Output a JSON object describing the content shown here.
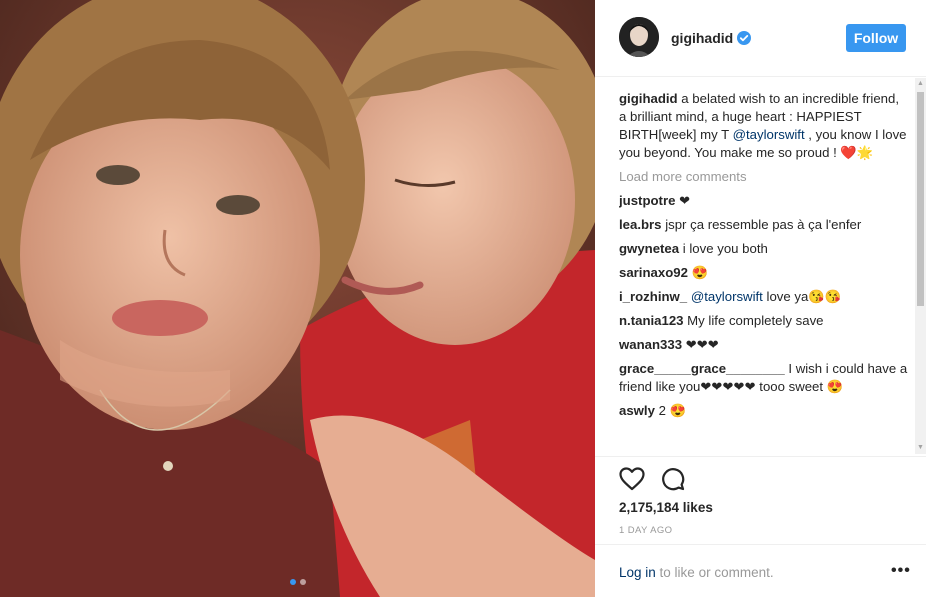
{
  "post": {
    "username": "gigihadid",
    "follow_label": "Follow",
    "caption": {
      "username": "gigihadid",
      "text_before": " a belated wish to an incredible friend, a brilliant mind, a huge heart : HAPPIEST BIRTH[week] my T ",
      "mention": "@taylorswift",
      "text_after": " , you know I love you beyond. You make me so proud ! ❤️🌟"
    },
    "load_more": "Load more comments",
    "comments": [
      {
        "user": "justpotre",
        "mention": "",
        "text": " ❤"
      },
      {
        "user": "lea.brs",
        "mention": "",
        "text": " jspr ça ressemble pas à ça l'enfer"
      },
      {
        "user": "gwynetea",
        "mention": "",
        "text": " i love you both"
      },
      {
        "user": "sarinaxo92",
        "mention": "",
        "text": " 😍"
      },
      {
        "user": "i_rozhinw_",
        "mention": " @taylorswift",
        "text": " love ya😘😘"
      },
      {
        "user": "n.tania123",
        "mention": "",
        "text": " My life completely save"
      },
      {
        "user": "wanan333",
        "mention": "",
        "text": " ❤❤❤"
      },
      {
        "user": "grace_____grace________",
        "mention": "",
        "text": " I wish i could have a friend like you❤❤❤❤❤ tooo sweet 😍"
      },
      {
        "user": "aswly",
        "mention": "",
        "text": " 2 😍"
      }
    ],
    "likes": "2,175,184 likes",
    "timestamp": "1 DAY AGO",
    "login_link": "Log in",
    "login_suffix": " to like or comment.",
    "more_icon": "•••",
    "carousel": {
      "count": 2,
      "active_index": 0
    }
  },
  "colors": {
    "accent": "#3897f0",
    "link": "#003569",
    "muted": "#999999",
    "text": "#262626"
  },
  "icons": [
    "verified-badge-icon",
    "heart-icon",
    "comment-icon",
    "more-options-icon"
  ]
}
